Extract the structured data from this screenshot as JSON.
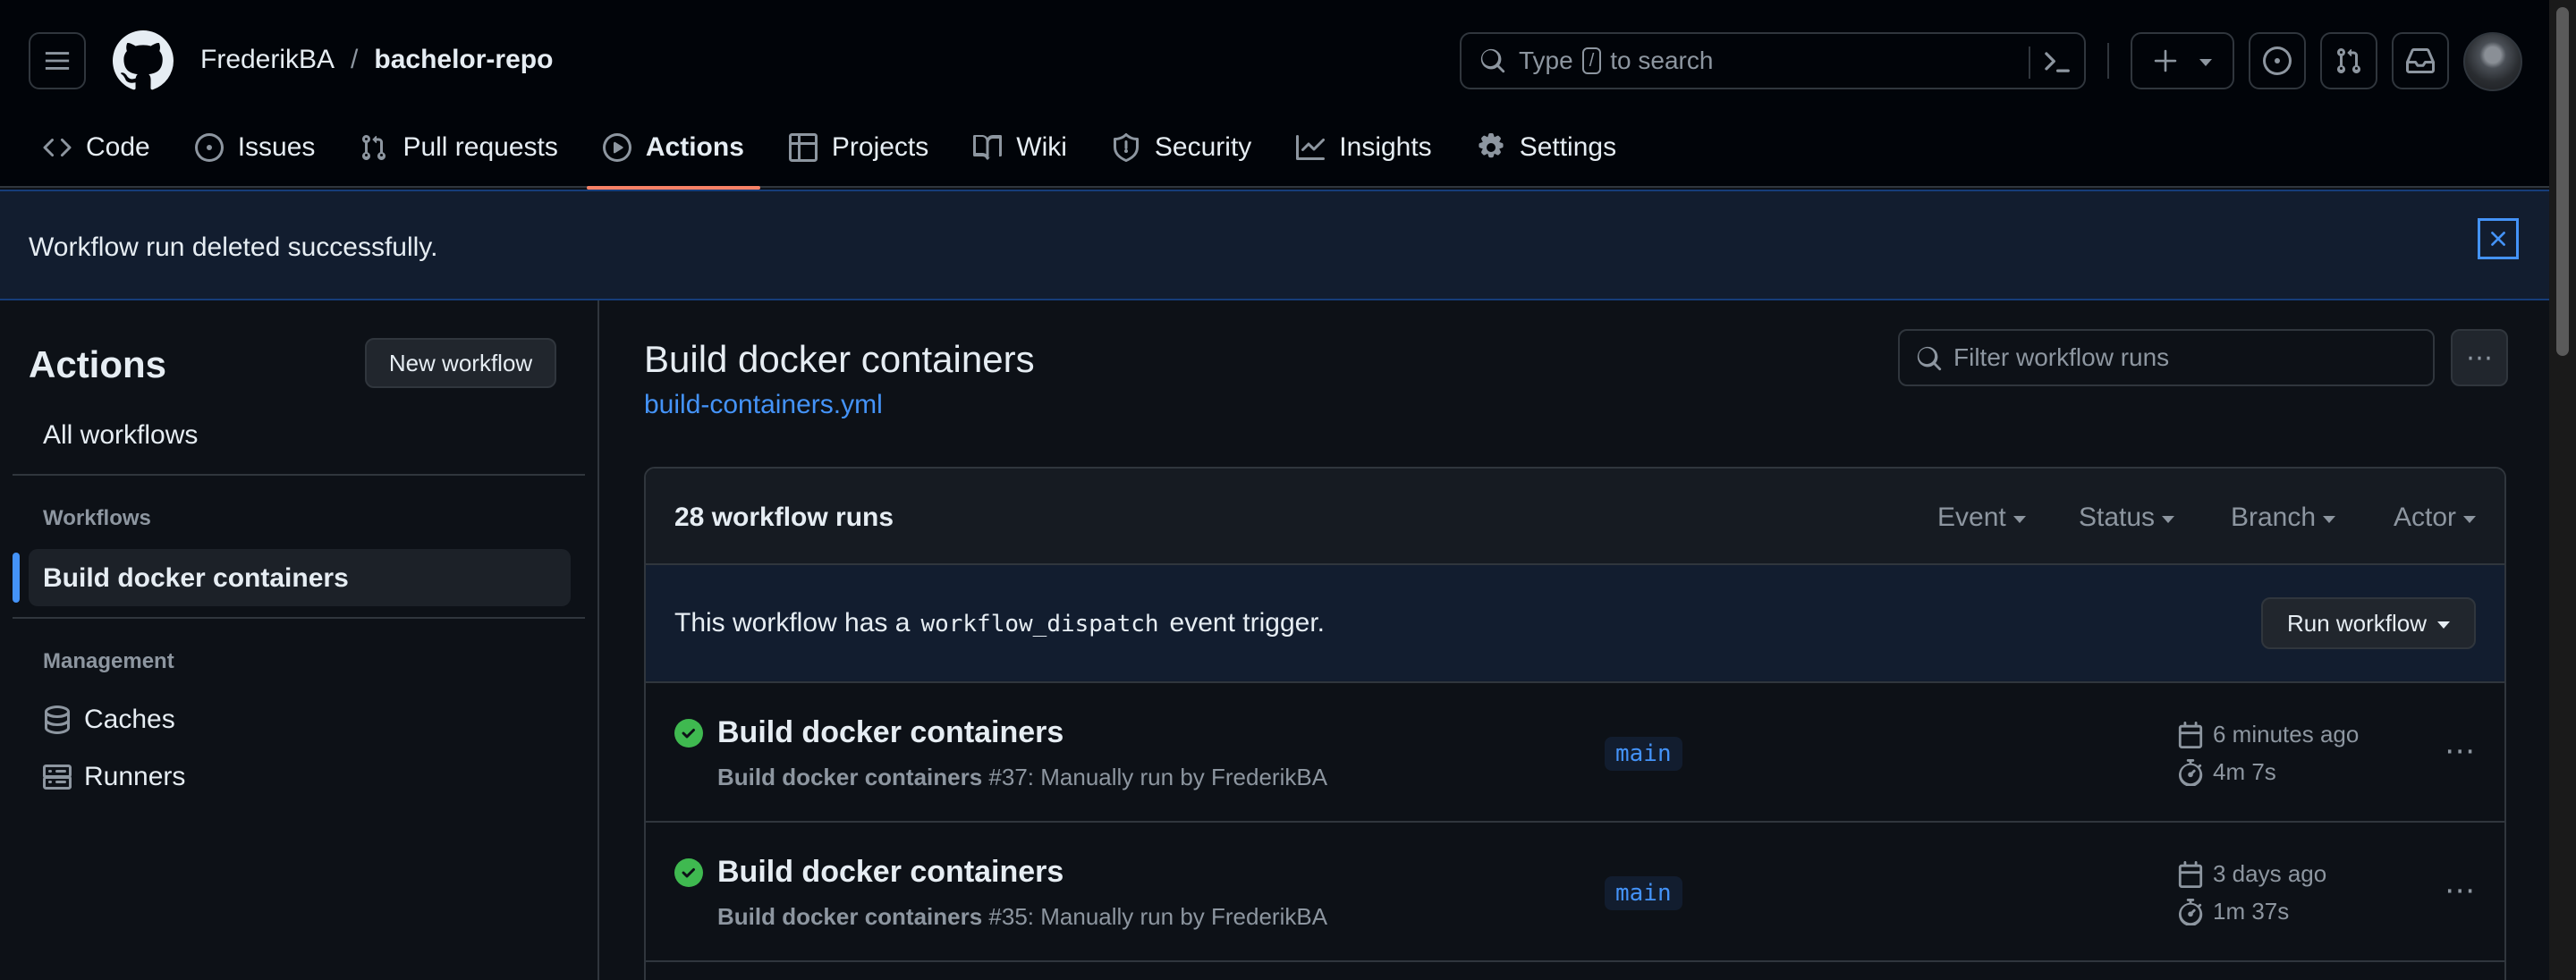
{
  "header": {
    "owner": "FrederikBA",
    "separator": "/",
    "repo": "bachelor-repo",
    "search_prefix": "Type",
    "search_key": "/",
    "search_suffix": "to search"
  },
  "nav": {
    "code": "Code",
    "issues": "Issues",
    "pull_requests": "Pull requests",
    "actions": "Actions",
    "projects": "Projects",
    "wiki": "Wiki",
    "security": "Security",
    "insights": "Insights",
    "settings": "Settings"
  },
  "flash": {
    "message": "Workflow run deleted successfully."
  },
  "sidebar": {
    "title": "Actions",
    "new_workflow": "New workflow",
    "all_workflows": "All workflows",
    "workflows_heading": "Workflows",
    "active_workflow": "Build docker containers",
    "management_heading": "Management",
    "caches": "Caches",
    "runners": "Runners"
  },
  "main": {
    "title": "Build docker containers",
    "file": "build-containers.yml",
    "filter_placeholder": "Filter workflow runs",
    "runs_count": "28 workflow runs",
    "filters": {
      "event": "Event",
      "status": "Status",
      "branch": "Branch",
      "actor": "Actor"
    },
    "dispatch": {
      "before": "This workflow has a",
      "code": "workflow_dispatch",
      "after": "event trigger."
    },
    "run_workflow": "Run workflow",
    "runs": [
      {
        "title": "Build docker containers",
        "workflow": "Build docker containers",
        "detail": "#37: Manually run by FrederikBA",
        "branch": "main",
        "when": "6 minutes ago",
        "duration": "4m 7s"
      },
      {
        "title": "Build docker containers",
        "workflow": "Build docker containers",
        "detail": "#35: Manually run by FrederikBA",
        "branch": "main",
        "when": "3 days ago",
        "duration": "1m 37s"
      }
    ]
  },
  "colors": {
    "accent": "#4493f8",
    "success": "#3fb950",
    "underline": "#f78166",
    "background": "#0d1117"
  }
}
